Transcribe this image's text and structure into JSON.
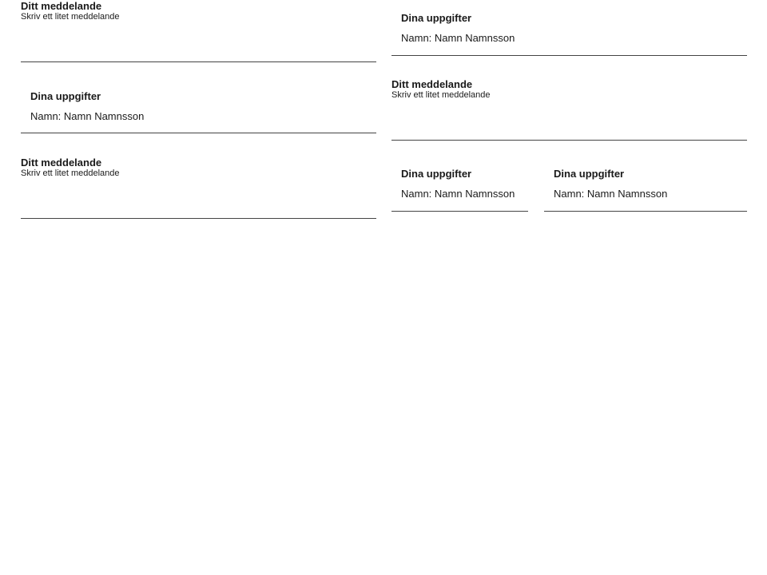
{
  "message_label": "Ditt meddelande",
  "message_hint": "Skriv ett litet meddelande",
  "details_label": "Dina uppgifter",
  "details_name": "Namn: Namn Namnsson"
}
